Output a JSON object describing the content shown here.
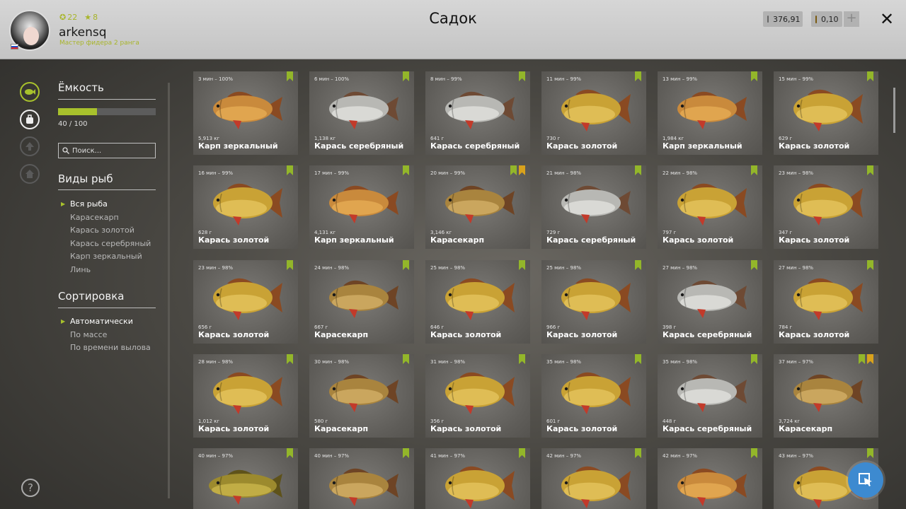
{
  "header": {
    "title": "Садок",
    "player": {
      "name": "arkensq",
      "rank": "Мастер фидера 2 ранга",
      "level": "22",
      "stars": "8"
    },
    "currency": {
      "silver": "376,91",
      "gold": "0,10"
    },
    "plus_label": "+",
    "close_label": "✕"
  },
  "sidebar": {
    "capacity_title": "Ёмкость",
    "capacity_text": "40 / 100",
    "capacity_fraction": 0.4,
    "search_placeholder": "Поиск...",
    "species_title": "Виды рыб",
    "species": [
      "Вся рыба",
      "Карасекарп",
      "Карась золотой",
      "Карась серебряный",
      "Карп зеркальный",
      "Линь"
    ],
    "species_selected": 0,
    "sort_title": "Сортировка",
    "sort": [
      "Автоматически",
      "По массе",
      "По времени вылова"
    ],
    "sort_selected": 0,
    "help_label": "?"
  },
  "grid": [
    [
      {
        "time": "3 мин – 100%",
        "weight": "5,913 кг",
        "name": "Карп зеркальный",
        "fish": "mirror-carp",
        "badges": [
          "green"
        ]
      },
      {
        "time": "6 мин – 100%",
        "weight": "1,138 кг",
        "name": "Карась серебряный",
        "fish": "silver-crucian",
        "badges": [
          "green"
        ]
      },
      {
        "time": "8 мин – 99%",
        "weight": "641 г",
        "name": "Карась серебряный",
        "fish": "silver-crucian",
        "badges": [
          "green"
        ]
      },
      {
        "time": "11 мин – 99%",
        "weight": "730 г",
        "name": "Карась золотой",
        "fish": "golden-crucian",
        "badges": [
          "green"
        ]
      },
      {
        "time": "13 мин – 99%",
        "weight": "1,984 кг",
        "name": "Карп зеркальный",
        "fish": "mirror-carp",
        "badges": [
          "green"
        ]
      },
      {
        "time": "15 мин – 99%",
        "weight": "629 г",
        "name": "Карась золотой",
        "fish": "golden-crucian",
        "badges": [
          "green"
        ]
      }
    ],
    [
      {
        "time": "16 мин – 99%",
        "weight": "628 г",
        "name": "Карась золотой",
        "fish": "golden-crucian",
        "badges": [
          "green"
        ]
      },
      {
        "time": "17 мин – 99%",
        "weight": "4,131 кг",
        "name": "Карп зеркальный",
        "fish": "mirror-carp",
        "badges": [
          "green"
        ]
      },
      {
        "time": "20 мин – 99%",
        "weight": "3,146 кг",
        "name": "Карасекарп",
        "fish": "hybrid",
        "badges": [
          "green",
          "gold"
        ]
      },
      {
        "time": "21 мин – 98%",
        "weight": "729 г",
        "name": "Карась серебряный",
        "fish": "silver-crucian",
        "badges": [
          "green"
        ]
      },
      {
        "time": "22 мин – 98%",
        "weight": "797 г",
        "name": "Карась золотой",
        "fish": "golden-crucian",
        "badges": [
          "green"
        ]
      },
      {
        "time": "23 мин – 98%",
        "weight": "347 г",
        "name": "Карась золотой",
        "fish": "golden-crucian",
        "badges": [
          "green"
        ]
      }
    ],
    [
      {
        "time": "23 мин – 98%",
        "weight": "656 г",
        "name": "Карась золотой",
        "fish": "golden-crucian",
        "badges": [
          "green"
        ]
      },
      {
        "time": "24 мин – 98%",
        "weight": "667 г",
        "name": "Карасекарп",
        "fish": "hybrid",
        "badges": [
          "green"
        ]
      },
      {
        "time": "25 мин – 98%",
        "weight": "646 г",
        "name": "Карась золотой",
        "fish": "golden-crucian",
        "badges": [
          "green"
        ]
      },
      {
        "time": "25 мин – 98%",
        "weight": "966 г",
        "name": "Карась золотой",
        "fish": "golden-crucian",
        "badges": [
          "green"
        ]
      },
      {
        "time": "27 мин – 98%",
        "weight": "398 г",
        "name": "Карась серебряный",
        "fish": "silver-crucian",
        "badges": [
          "green"
        ]
      },
      {
        "time": "27 мин – 98%",
        "weight": "784 г",
        "name": "Карась золотой",
        "fish": "golden-crucian",
        "badges": [
          "green"
        ]
      }
    ],
    [
      {
        "time": "28 мин – 98%",
        "weight": "1,012 кг",
        "name": "Карась золотой",
        "fish": "golden-crucian",
        "badges": [
          "green"
        ]
      },
      {
        "time": "30 мин – 98%",
        "weight": "580 г",
        "name": "Карасекарп",
        "fish": "hybrid",
        "badges": [
          "green"
        ]
      },
      {
        "time": "31 мин – 98%",
        "weight": "356 г",
        "name": "Карась золотой",
        "fish": "golden-crucian",
        "badges": [
          "green"
        ]
      },
      {
        "time": "35 мин – 98%",
        "weight": "601 г",
        "name": "Карась золотой",
        "fish": "golden-crucian",
        "badges": [
          "green"
        ]
      },
      {
        "time": "35 мин – 98%",
        "weight": "448 г",
        "name": "Карась серебряный",
        "fish": "silver-crucian",
        "badges": [
          "green"
        ]
      },
      {
        "time": "37 мин – 97%",
        "weight": "3,724 кг",
        "name": "Карасекарп",
        "fish": "hybrid",
        "badges": [
          "green",
          "gold"
        ]
      }
    ],
    [
      {
        "time": "40 мин – 97%",
        "weight": "",
        "name": "",
        "fish": "tench",
        "badges": [
          "green"
        ]
      },
      {
        "time": "40 мин – 97%",
        "weight": "",
        "name": "",
        "fish": "hybrid",
        "badges": [
          "green"
        ]
      },
      {
        "time": "41 мин – 97%",
        "weight": "",
        "name": "",
        "fish": "golden-crucian",
        "badges": [
          "green"
        ]
      },
      {
        "time": "42 мин – 97%",
        "weight": "",
        "name": "",
        "fish": "golden-crucian",
        "badges": [
          "green"
        ]
      },
      {
        "time": "42 мин – 97%",
        "weight": "",
        "name": "",
        "fish": "mirror-carp",
        "badges": [
          "green"
        ]
      },
      {
        "time": "43 мин – 97%",
        "weight": "",
        "name": "",
        "fish": "golden-crucian",
        "badges": [
          "green"
        ]
      }
    ]
  ],
  "colors": {
    "accent": "#a8c12c",
    "badge_green": "#93b62a",
    "badge_gold": "#d9a21c",
    "fab": "#3d8ad0",
    "fish": {
      "golden-crucian": {
        "body": "#c9a235",
        "belly": "#e6c560",
        "fin": "#8a4a22"
      },
      "silver-crucian": {
        "body": "#b8b8b4",
        "belly": "#e4e4e0",
        "fin": "#6e4a34"
      },
      "mirror-carp": {
        "body": "#c98a3c",
        "belly": "#e7ae55",
        "fin": "#8a4a22"
      },
      "hybrid": {
        "body": "#a9843e",
        "belly": "#d5b26a",
        "fin": "#6e4425"
      },
      "tench": {
        "body": "#9c8a2e",
        "belly": "#cdb84e",
        "fin": "#5e521a"
      }
    }
  }
}
